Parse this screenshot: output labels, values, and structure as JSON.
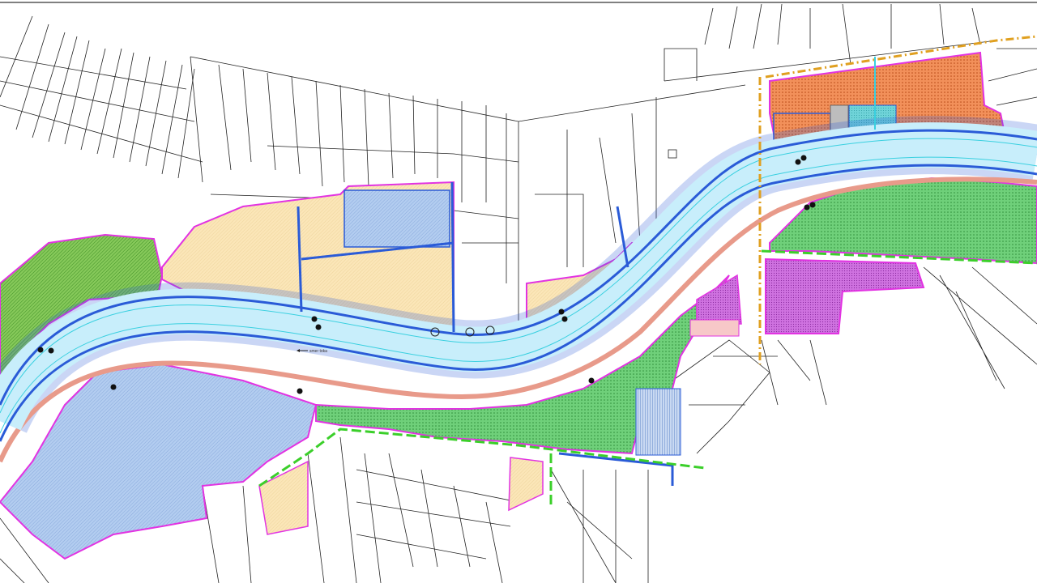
{
  "map": {
    "flow_label": "smer toka",
    "colors": {
      "river": "#c8eefb",
      "river_edge": "#2a5bd7",
      "bank_pink": "#e89a8a",
      "green_zone": "#5fcf6a",
      "green_hatch": "#3fa64a",
      "forest": "#79c24a",
      "yellow_zone": "#fbe3b0",
      "blue_zone": "#a9c6ee",
      "orange_zone": "#f08a4b",
      "purple_zone": "#c55ad8",
      "cyan_zone": "#5fd0d6",
      "boundary_magenta": "#e233e2",
      "boundary_green_dash": "#3bcf2a",
      "boundary_orange_dash": "#e0a020",
      "parcel_line": "#222222"
    },
    "layers": [
      "river-channel",
      "river-banks",
      "riparian-green-zones",
      "forest-zone",
      "agricultural-zones",
      "built-zones",
      "cadastral-parcels",
      "project-boundaries"
    ]
  }
}
